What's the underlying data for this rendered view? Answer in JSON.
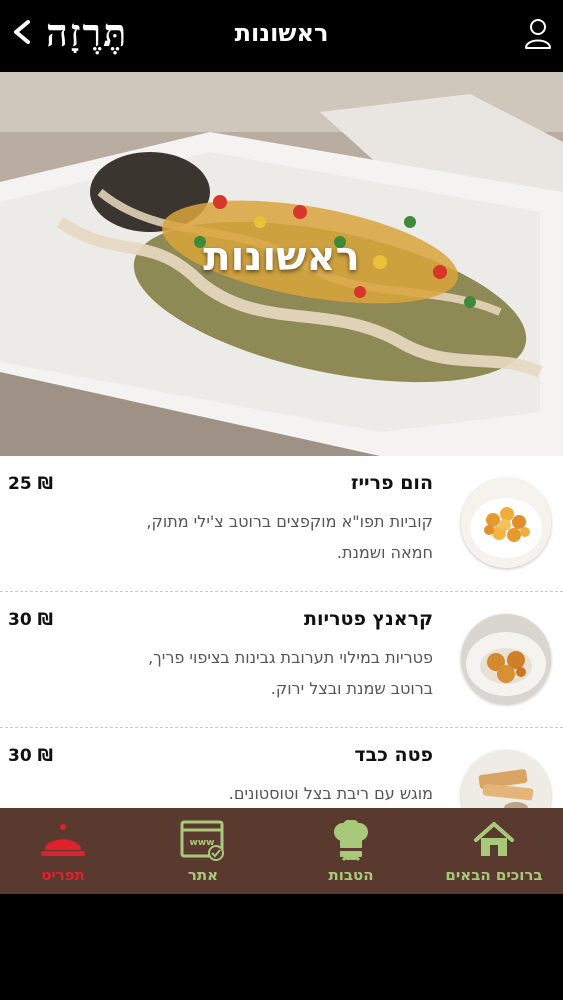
{
  "header": {
    "logo_text": "תֶּרֶזָה",
    "title": "ראשונות",
    "back_icon": "chevron-left-icon",
    "user_icon": "user-icon"
  },
  "hero": {
    "title": "ראשונות"
  },
  "menu_items": [
    {
      "name": "הום פרייז",
      "description": "קוביות תפו\"א מוקפצים ברוטב צ'ילי מתוק, חמאה ושמנת.",
      "price": "25 ₪",
      "image": "fries-dish"
    },
    {
      "name": "קראנץ פטריות",
      "description": "פטריות במילוי תערובת גבינות בציפוי פריך, ברוטב שמנת ובצל ירוק.",
      "price": "30 ₪",
      "image": "mushroom-balls-dish"
    },
    {
      "name": "פטה כבד",
      "description": "מוגש עם ריבת בצל וטוסטונים.",
      "price": "30 ₪",
      "image": "pate-toast-dish"
    }
  ],
  "tabbar": {
    "tabs": [
      {
        "label": "תפריט",
        "icon": "cloche-icon",
        "active": true
      },
      {
        "label": "אתר",
        "icon": "website-icon",
        "active": false
      },
      {
        "label": "הטבות",
        "icon": "chef-hat-icon",
        "active": false
      },
      {
        "label": "ברוכים הבאים",
        "icon": "home-icon",
        "active": false
      }
    ]
  },
  "colors": {
    "tabbar_bg": "#5a3a2f",
    "tab_active": "#e0202a",
    "tab_inactive": "#a9c97a",
    "header_bg": "#000000"
  }
}
